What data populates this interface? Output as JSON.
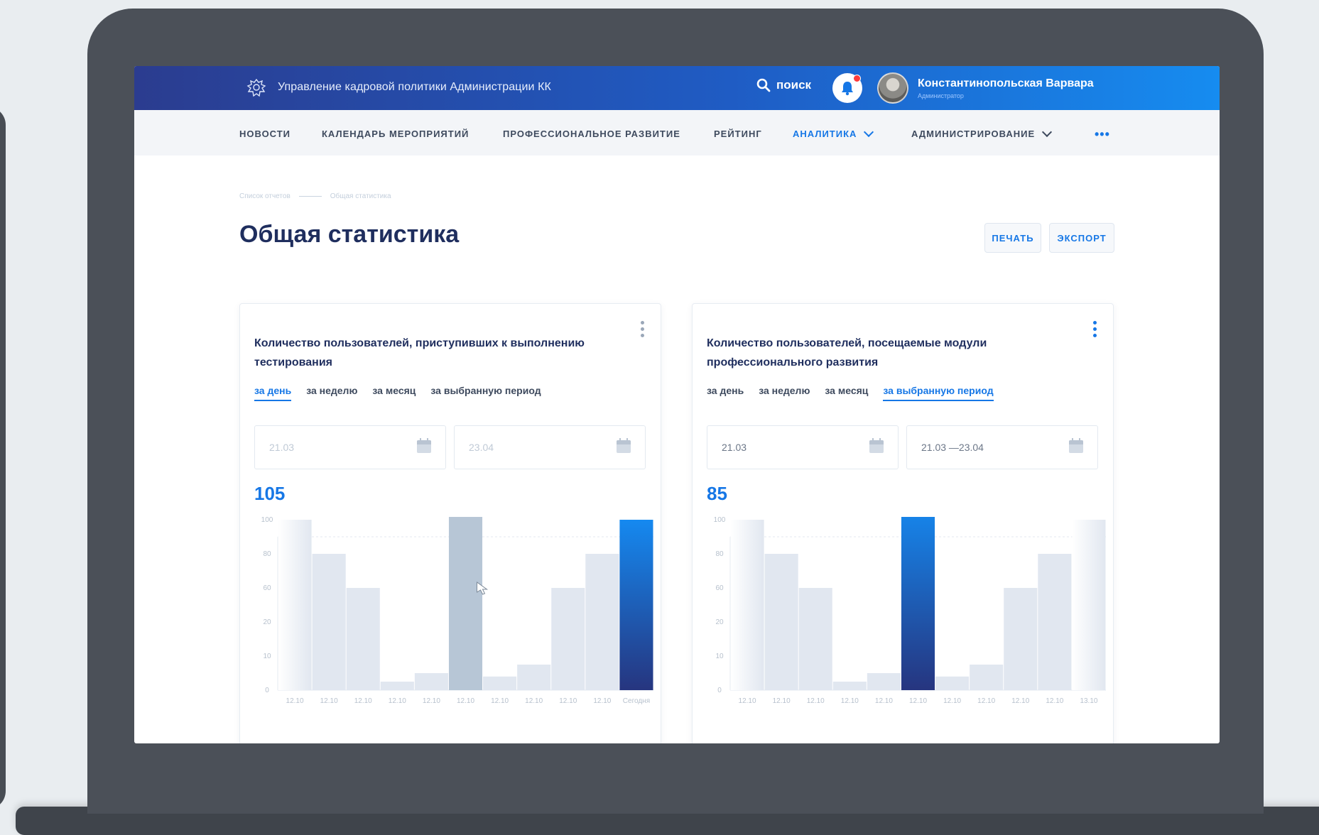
{
  "header": {
    "org_title": "Управление кадровой политики Администрации КК",
    "search_label": "поиск",
    "user_name": "Константинопольская Варвара",
    "user_role": "Администратор",
    "accent": "#1677e6",
    "gradient": [
      "#2b3c8f",
      "#168cf0"
    ],
    "icons": [
      "crest-icon",
      "search-icon",
      "bell-icon",
      "avatar"
    ]
  },
  "nav": {
    "items": [
      {
        "label": "НОВОСТИ"
      },
      {
        "label": "КАЛЕНДАРЬ МЕРОПРИЯТИЙ"
      },
      {
        "label": "ПРОФЕССИОНАЛЬНОЕ РАЗВИТИЕ"
      },
      {
        "label": "РЕЙТИНГ"
      },
      {
        "label": "АНАЛИТИКА",
        "active": true,
        "dropdown": true
      },
      {
        "label": "АДМИНИСТРИРОВАНИЕ",
        "dropdown": true
      }
    ],
    "more_label": "•••"
  },
  "breadcrumb": {
    "items": [
      "Список отчетов",
      "Общая статистика"
    ]
  },
  "page": {
    "title": "Общая статистика",
    "print_label": "ПЕЧАТЬ",
    "export_label": "ЭКСПОРТ"
  },
  "cards": [
    {
      "title": "Количество пользователей, приступивших к выполнению тестирования",
      "tabs": [
        "за день",
        "за неделю",
        "за месяц",
        "за выбранную период"
      ],
      "active_tab": 0,
      "date_from": "21.03",
      "date_to": "23.04",
      "total": "105"
    },
    {
      "title": "Количество пользователей, посещаемые модули профессионального развития",
      "tabs": [
        "за день",
        "за неделю",
        "за месяц",
        "за выбранную период"
      ],
      "active_tab": 3,
      "date_from": "21.03",
      "date_to": "21.03 —23.04",
      "total": "85"
    }
  ],
  "chart_data": [
    {
      "type": "bar",
      "y_tick_labels": [
        "0",
        "10",
        "20",
        "60",
        "80",
        "100"
      ],
      "categories": [
        "12.10",
        "12.10",
        "12.10",
        "12.10",
        "12.10",
        "12.10",
        "12.10",
        "12.10",
        "12.10",
        "12.10",
        "Сегодня"
      ],
      "values": [
        100,
        80,
        60,
        5,
        10,
        110,
        8,
        15,
        60,
        80,
        100
      ],
      "highlight_index": 5,
      "highlight_style": "hover",
      "accent_index": 10,
      "bar_color": "#e1e7f0",
      "hover_color": "#b7c6d6",
      "accent_gradient": [
        "#1589f0",
        "#26357f"
      ]
    },
    {
      "type": "bar",
      "y_tick_labels": [
        "0",
        "10",
        "20",
        "60",
        "80",
        "100"
      ],
      "categories": [
        "12.10",
        "12.10",
        "12.10",
        "12.10",
        "12.10",
        "12.10",
        "12.10",
        "12.10",
        "12.10",
        "12.10",
        "13.10"
      ],
      "values": [
        100,
        80,
        60,
        5,
        10,
        110,
        8,
        15,
        60,
        80,
        100
      ],
      "accent_index": 5,
      "bar_color": "#e1e7f0",
      "accent_gradient": [
        "#1589f0",
        "#26357f"
      ]
    }
  ]
}
